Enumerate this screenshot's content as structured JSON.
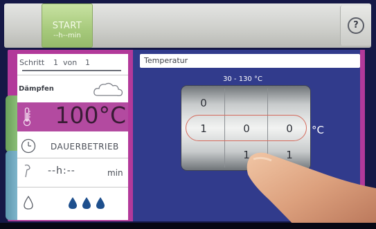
{
  "topbar": {
    "start_label": "START",
    "start_time": "--h--min",
    "help_label": "?"
  },
  "program": {
    "step_word": "Schritt",
    "step_current": "1",
    "step_of": "von",
    "step_total": "1",
    "mode_name": "Dämpfen",
    "temperature": "100°C",
    "duration_mode": "DAUERBETRIEB",
    "time_value": "--h:--",
    "time_unit": "min",
    "steam_level": "💧💧💧"
  },
  "editor": {
    "title": "Temperatur",
    "range": "30 - 130 °C",
    "unit": "°C",
    "digits_above": [
      "0",
      "",
      ""
    ],
    "digits_selected": [
      "1",
      "0",
      "0"
    ],
    "digits_below": [
      "",
      "1",
      "1"
    ]
  },
  "colors": {
    "accent_magenta": "#b2399a",
    "start_green": "#a6c97b",
    "panel_blue": "#313b8c"
  }
}
